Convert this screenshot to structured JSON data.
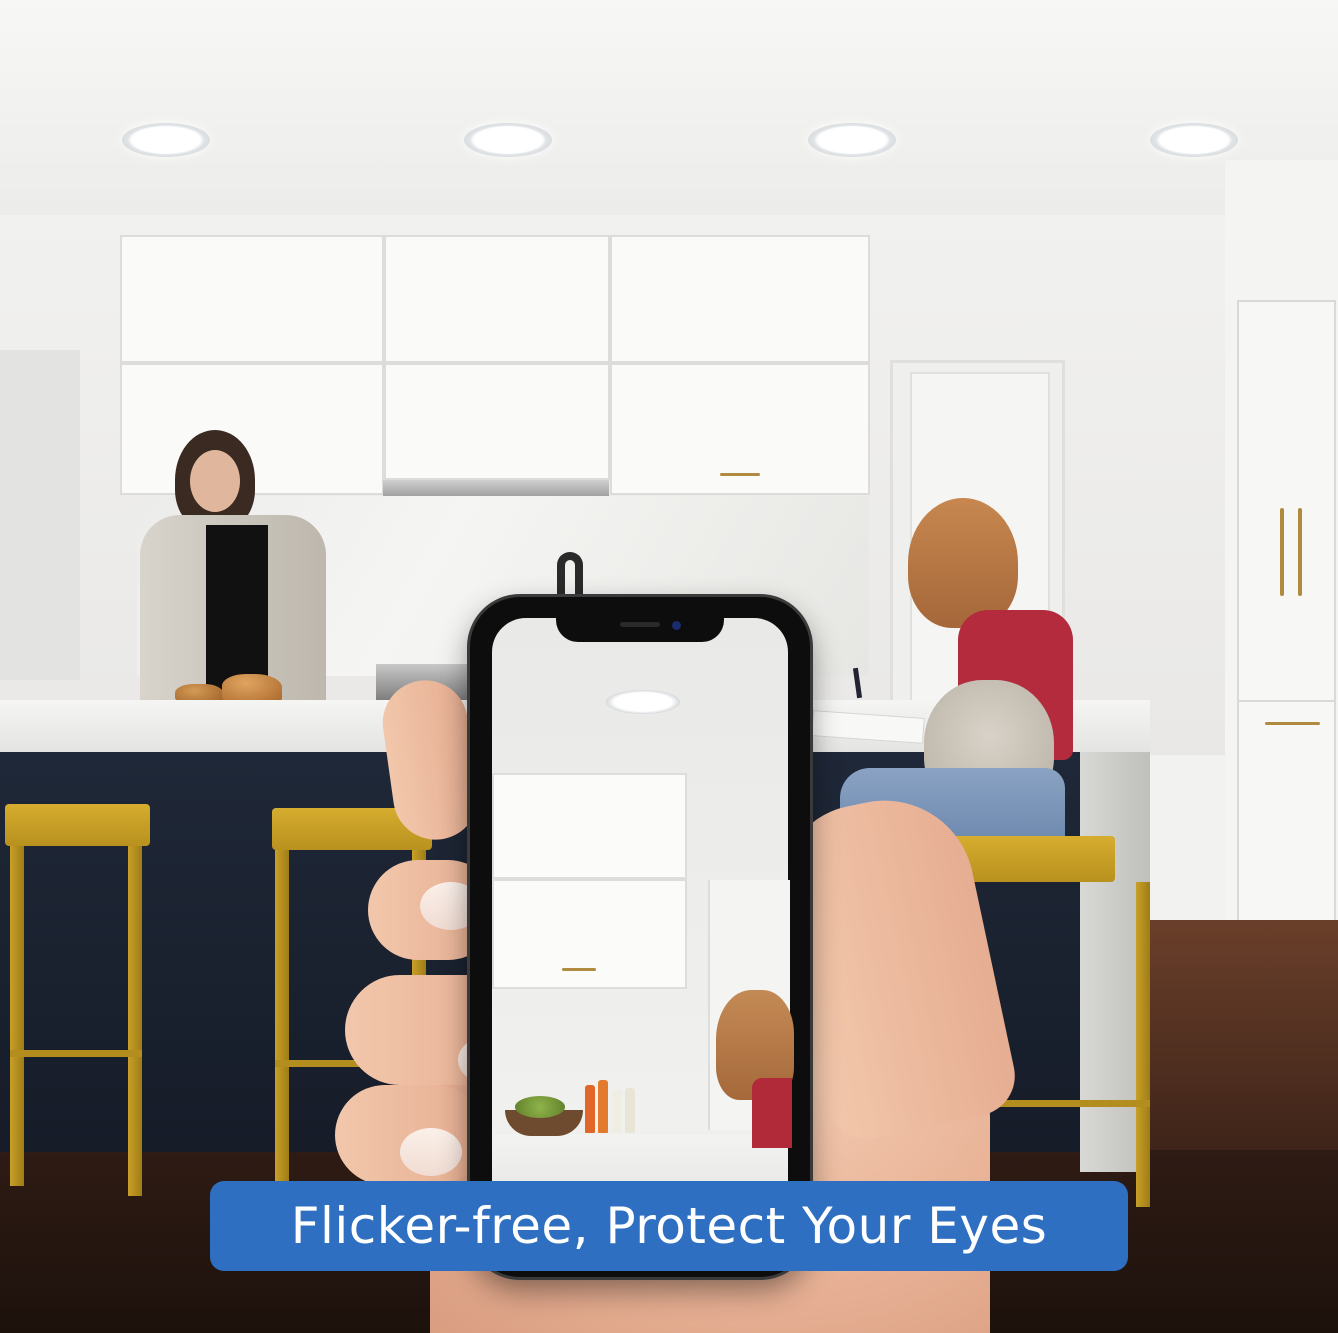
{
  "banner": {
    "text": "Flicker-free, Protect Your Eyes",
    "background_color": "#2e6fc1",
    "text_color": "#ffffff"
  },
  "scene": {
    "setting": "kitchen",
    "icons": [
      "recessed-downlight",
      "smartphone",
      "hand"
    ]
  }
}
